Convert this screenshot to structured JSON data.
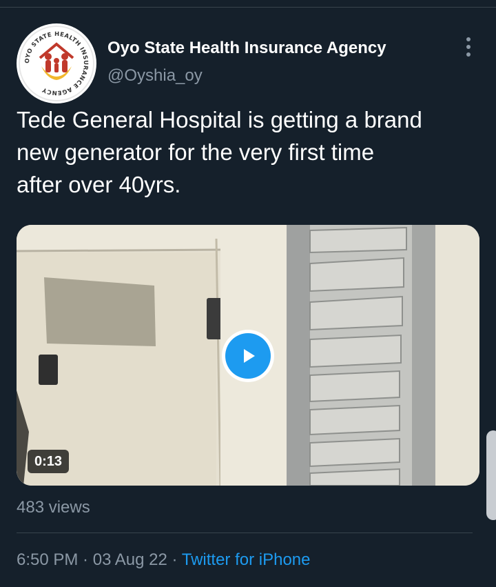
{
  "author": {
    "name": "Oyo State Health Insurance Agency",
    "handle": "@Oyshia_oy",
    "avatar_ring_text": "OYO STATE HEALTH INSURANCE AGENCY"
  },
  "tweet": {
    "text_lines": [
      "Tede General Hospital is getting a brand",
      "new generator for the very first time",
      "after over 40yrs."
    ]
  },
  "media": {
    "type": "video",
    "duration": "0:13",
    "play_icon": "play-icon"
  },
  "stats": {
    "views": "483 views"
  },
  "meta": {
    "time": "6:50 PM",
    "separator": " · ",
    "date": "03 Aug 22",
    "source": "Twitter for iPhone"
  },
  "colors": {
    "background": "#15202b",
    "accent": "#1d9bf0",
    "secondary_text": "#8b98a5",
    "divider": "#38444d"
  },
  "icons": {
    "more": "more-vertical-icon"
  }
}
